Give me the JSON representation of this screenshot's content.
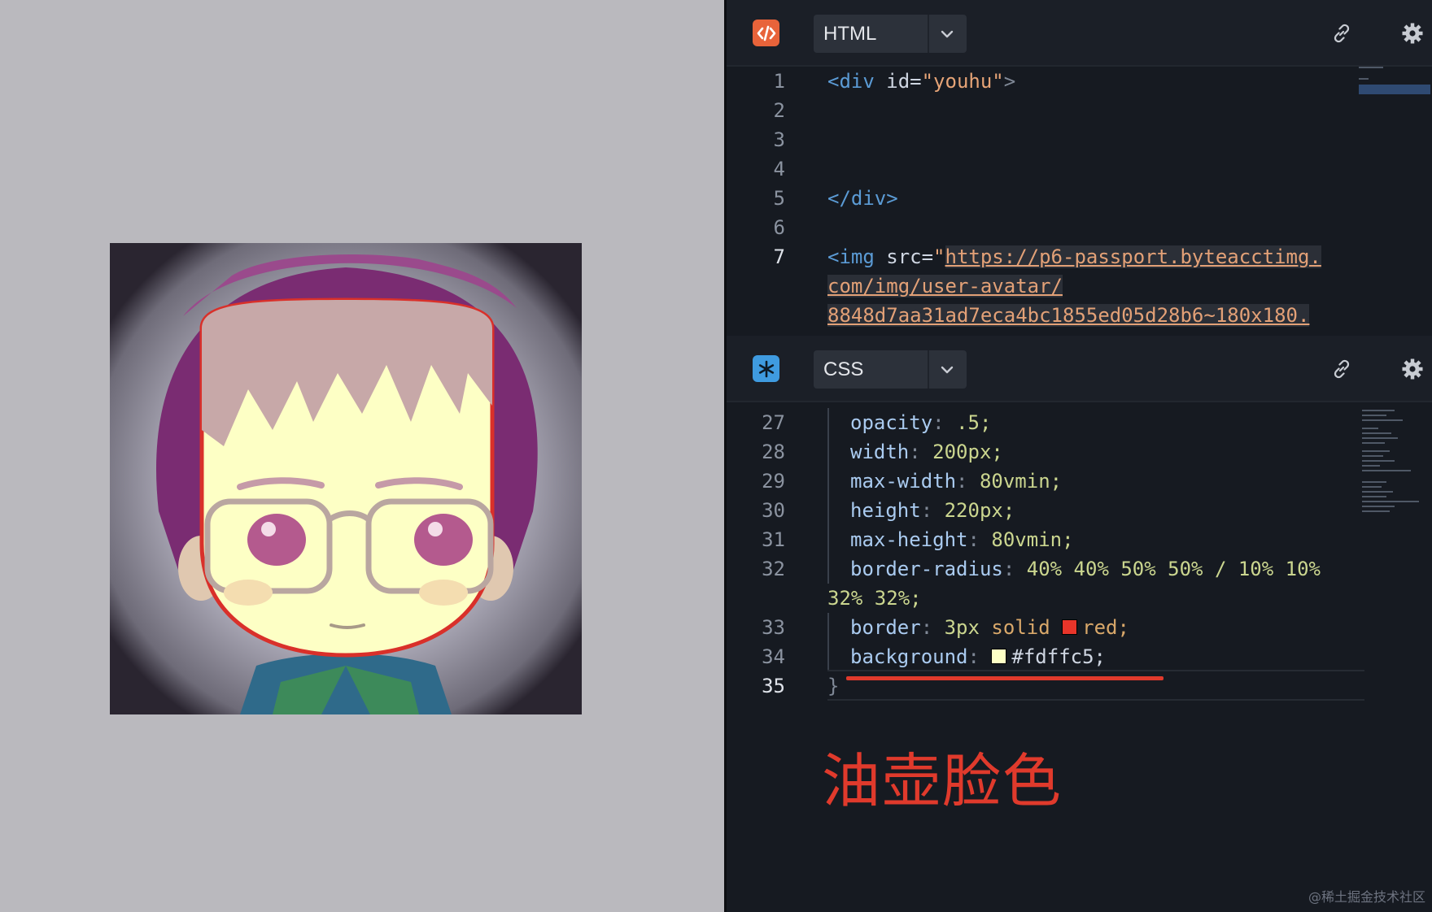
{
  "preview": {
    "avatar_alt": "cartoon avatar with glasses"
  },
  "html_panel": {
    "language": "HTML",
    "badge_glyph": "</>",
    "lines": [
      {
        "num": "1"
      },
      {
        "num": "2"
      },
      {
        "num": "3"
      },
      {
        "num": "4"
      },
      {
        "num": "5"
      },
      {
        "num": "6"
      },
      {
        "num": "7"
      }
    ],
    "code": {
      "line1_open": "<div",
      "line1_attr": " id=",
      "line1_val": "\"youhu\"",
      "line1_close": ">",
      "line5": "</div>",
      "line7_open": "<img",
      "line7_attr": " src=",
      "line7_quote": "\"",
      "url_part1": "https://p6-passport.byteacctimg.",
      "url_part2": "com/img/user-avatar/",
      "url_part3": "8848d7aa31ad7eca4bc1855ed05d28b6~180x180."
    }
  },
  "css_panel": {
    "language": "CSS",
    "lines": [
      {
        "num": "27",
        "prop": "opacity",
        "value": ".5;"
      },
      {
        "num": "28",
        "prop": "width",
        "value": "200px;"
      },
      {
        "num": "29",
        "prop": "max-width",
        "value": "80vmin;"
      },
      {
        "num": "30",
        "prop": "height",
        "value": "220px;"
      },
      {
        "num": "31",
        "prop": "max-height",
        "value": "80vmin;"
      },
      {
        "num": "32",
        "prop": "border-radius",
        "value": "40% 40% 50% 50% / 10% 10%",
        "wrap": "32% 32%;"
      },
      {
        "num": "33",
        "prop": "border",
        "value_a": "3px",
        "value_b": "solid",
        "value_c": "red;"
      },
      {
        "num": "34",
        "prop": "background",
        "value": "#fdffc5;"
      },
      {
        "num": "35",
        "text": "}"
      }
    ],
    "colors": {
      "red_swatch": "#e8352a",
      "bg_swatch": "#fdffc5"
    }
  },
  "annotation": {
    "text": "油壶脸色",
    "color": "#e03a2c"
  },
  "watermark": "@稀土掘金技术社区"
}
